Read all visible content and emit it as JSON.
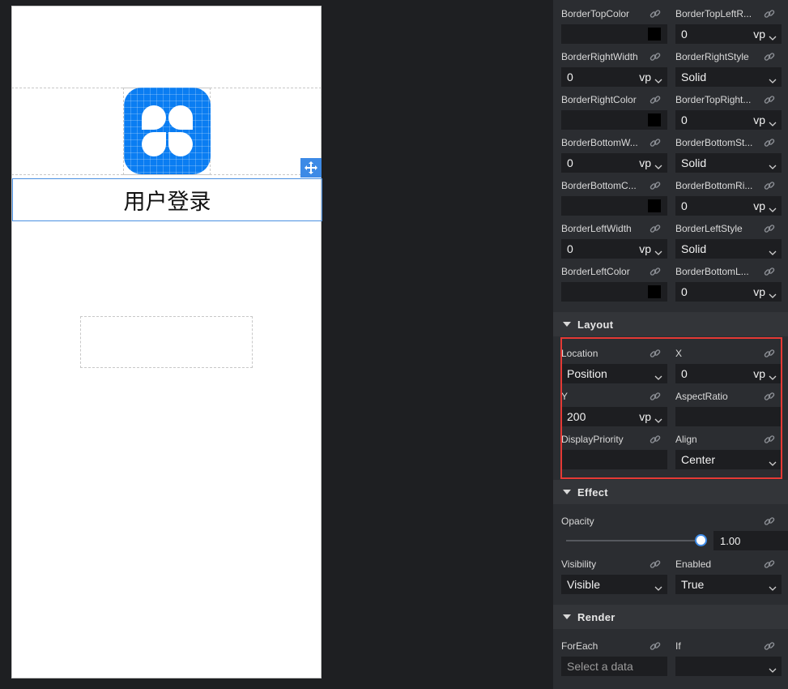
{
  "canvas": {
    "title_text": "用户登录"
  },
  "panel": {
    "border_props": [
      {
        "label": "BorderTopColor",
        "kind": "color",
        "color": "#000000"
      },
      {
        "label": "BorderTopLeftR...",
        "kind": "unit",
        "value": "0",
        "unit": "vp"
      },
      {
        "label": "BorderRightWidth",
        "kind": "unit",
        "value": "0",
        "unit": "vp"
      },
      {
        "label": "BorderRightStyle",
        "kind": "select",
        "value": "Solid"
      },
      {
        "label": "BorderRightColor",
        "kind": "color",
        "color": "#000000"
      },
      {
        "label": "BorderTopRight...",
        "kind": "unit",
        "value": "0",
        "unit": "vp"
      },
      {
        "label": "BorderBottomW...",
        "kind": "unit",
        "value": "0",
        "unit": "vp"
      },
      {
        "label": "BorderBottomSt...",
        "kind": "select",
        "value": "Solid"
      },
      {
        "label": "BorderBottomC...",
        "kind": "color",
        "color": "#000000"
      },
      {
        "label": "BorderBottomRi...",
        "kind": "unit",
        "value": "0",
        "unit": "vp"
      },
      {
        "label": "BorderLeftWidth",
        "kind": "unit",
        "value": "0",
        "unit": "vp"
      },
      {
        "label": "BorderLeftStyle",
        "kind": "select",
        "value": "Solid"
      },
      {
        "label": "BorderLeftColor",
        "kind": "color",
        "color": "#000000"
      },
      {
        "label": "BorderBottomL...",
        "kind": "unit",
        "value": "0",
        "unit": "vp"
      }
    ],
    "layout": {
      "header": "Layout",
      "props": [
        {
          "label": "Location",
          "kind": "select",
          "value": "Position"
        },
        {
          "label": "X",
          "kind": "unit",
          "value": "0",
          "unit": "vp"
        },
        {
          "label": "Y",
          "kind": "unit",
          "value": "200",
          "unit": "vp"
        },
        {
          "label": "AspectRatio",
          "kind": "empty"
        },
        {
          "label": "DisplayPriority",
          "kind": "empty"
        },
        {
          "label": "Align",
          "kind": "select",
          "value": "Center"
        }
      ]
    },
    "effect": {
      "header": "Effect",
      "opacity_label": "Opacity",
      "opacity_value": "1.00",
      "opacity_fraction": 1.0,
      "props": [
        {
          "label": "Visibility",
          "kind": "select",
          "value": "Visible"
        },
        {
          "label": "Enabled",
          "kind": "select",
          "value": "True"
        }
      ]
    },
    "render": {
      "header": "Render",
      "props": [
        {
          "label": "ForEach",
          "kind": "placeholder",
          "value": "Select a data"
        },
        {
          "label": "If",
          "kind": "select",
          "value": ""
        }
      ]
    }
  },
  "colors": {
    "accent": "#3d8ae6",
    "logo_blue": "#0a7df2",
    "highlight_red": "#e53935"
  }
}
